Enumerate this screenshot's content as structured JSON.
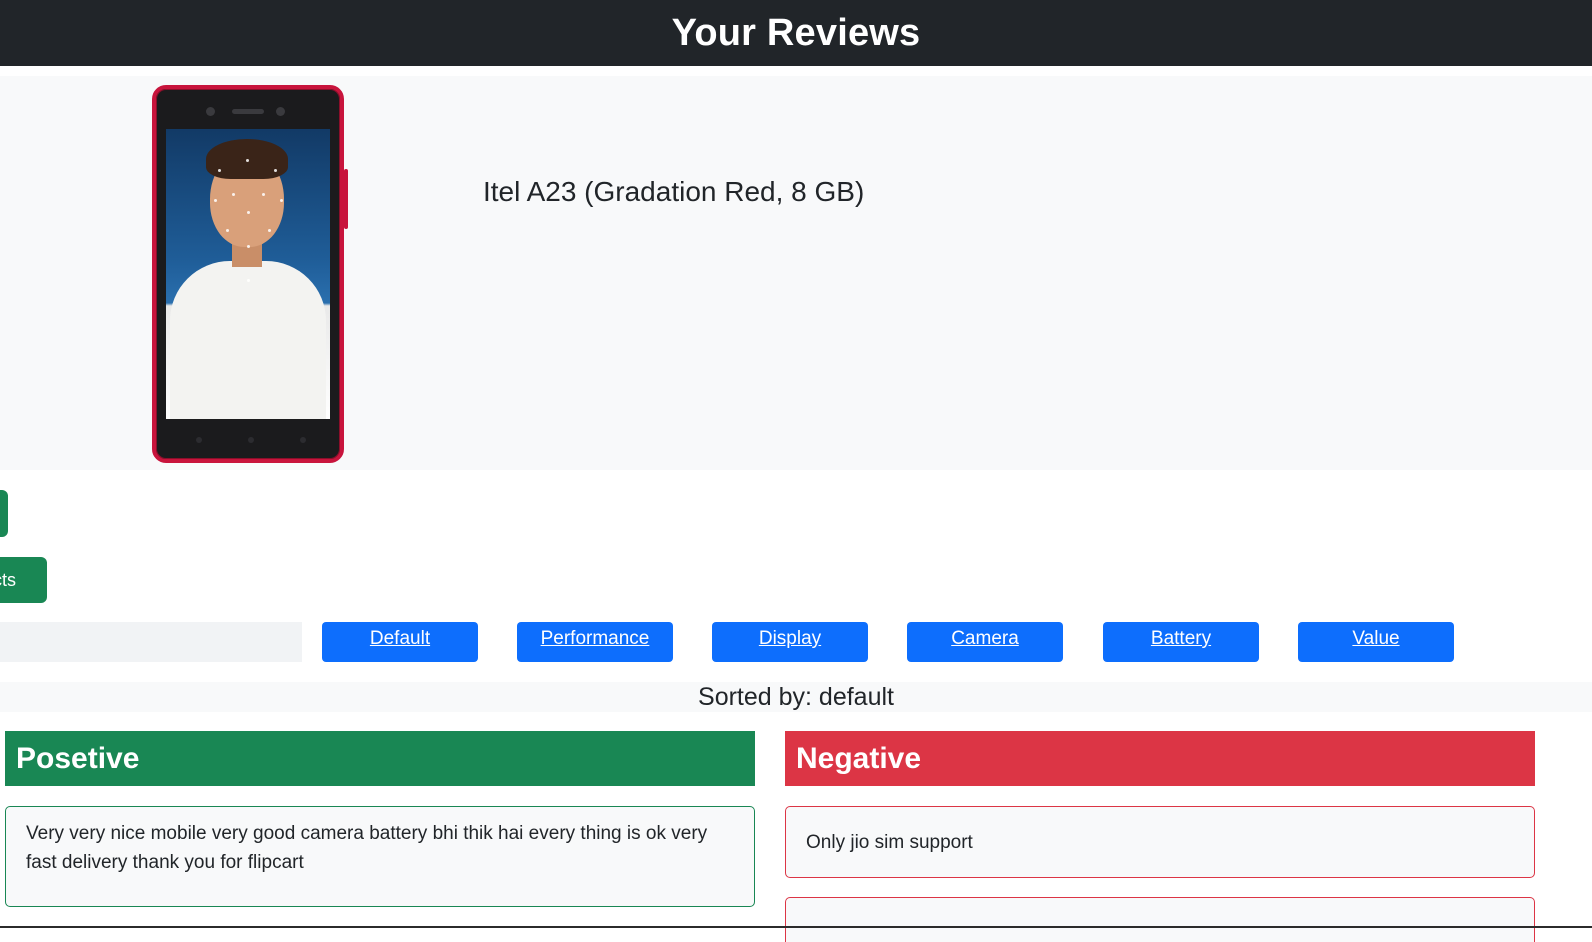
{
  "header": {
    "title": "Your Reviews"
  },
  "product": {
    "name": "Itel A23 (Gradation Red, 8 GB)",
    "image_icon": "phone-image"
  },
  "side_buttons": {
    "products_label_fragment": "ucts"
  },
  "filters": [
    "Default",
    "Performance",
    "Display",
    "Camera",
    "Battery",
    "Value"
  ],
  "sorted": {
    "label": "Sorted by: default"
  },
  "columns": {
    "positive": {
      "title": "Posetive"
    },
    "negative": {
      "title": "Negative"
    }
  },
  "reviews": {
    "positive": [
      "Very very nice mobile very good camera battery bhi thik hai every thing is ok very fast delivery thank you for flipcart"
    ],
    "negative": [
      "Only jio sim support",
      ""
    ]
  },
  "colors": {
    "header_bg": "#212529",
    "primary": "#0d6efd",
    "success": "#198754",
    "danger": "#dc3545",
    "light": "#f8f9fa",
    "phone_frame": "#c8143c"
  }
}
